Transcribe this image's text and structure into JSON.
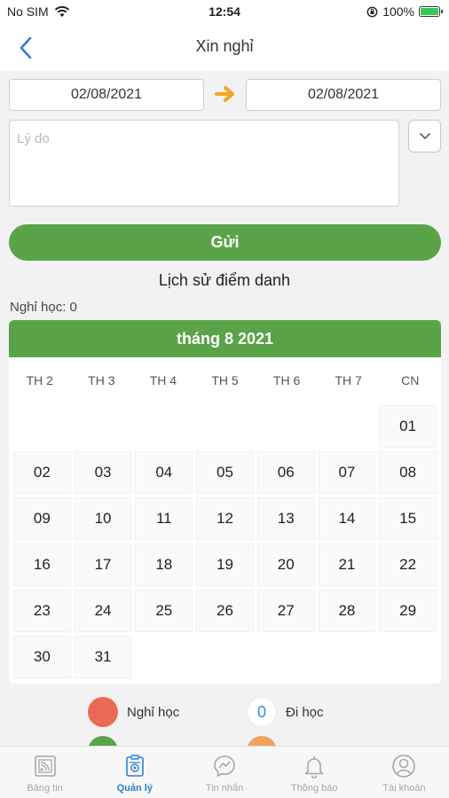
{
  "status_bar": {
    "carrier": "No SIM",
    "time": "12:54",
    "battery": "100%"
  },
  "nav": {
    "title": "Xin nghỉ"
  },
  "form": {
    "date_from": "02/08/2021",
    "date_to": "02/08/2021",
    "reason_placeholder": "Lý do",
    "send_label": "Gửi"
  },
  "history": {
    "title": "Lịch sử điểm danh",
    "absent_count": "Nghỉ học: 0"
  },
  "calendar": {
    "header": "tháng 8 2021",
    "weekdays": [
      "TH 2",
      "TH 3",
      "TH 4",
      "TH 5",
      "TH 6",
      "TH 7",
      "CN"
    ],
    "days": [
      "",
      "",
      "",
      "",
      "",
      "",
      "01",
      "02",
      "03",
      "04",
      "05",
      "06",
      "07",
      "08",
      "09",
      "10",
      "11",
      "12",
      "13",
      "14",
      "15",
      "16",
      "17",
      "18",
      "19",
      "20",
      "21",
      "22",
      "23",
      "24",
      "25",
      "26",
      "27",
      "28",
      "29",
      "30",
      "31"
    ]
  },
  "legend": {
    "absent_label": "Nghỉ học",
    "present_label": "Đi học",
    "present_count": "0",
    "absent_color": "#ea6a55",
    "present_border": "#dfe9f5",
    "green_color": "#5aa349",
    "orange_color": "#f2a35a"
  },
  "tabs": [
    {
      "label": "Bảng tin",
      "icon": "news-feed-icon"
    },
    {
      "label": "Quản lý",
      "icon": "management-icon",
      "active": true
    },
    {
      "label": "Tin nhắn",
      "icon": "messenger-icon"
    },
    {
      "label": "Thông báo",
      "icon": "bell-icon"
    },
    {
      "label": "Tài khoản",
      "icon": "account-icon"
    }
  ],
  "colors": {
    "accent": "#5aa349",
    "active_tab": "#2d7fd6",
    "arrow": "#f5a623"
  }
}
